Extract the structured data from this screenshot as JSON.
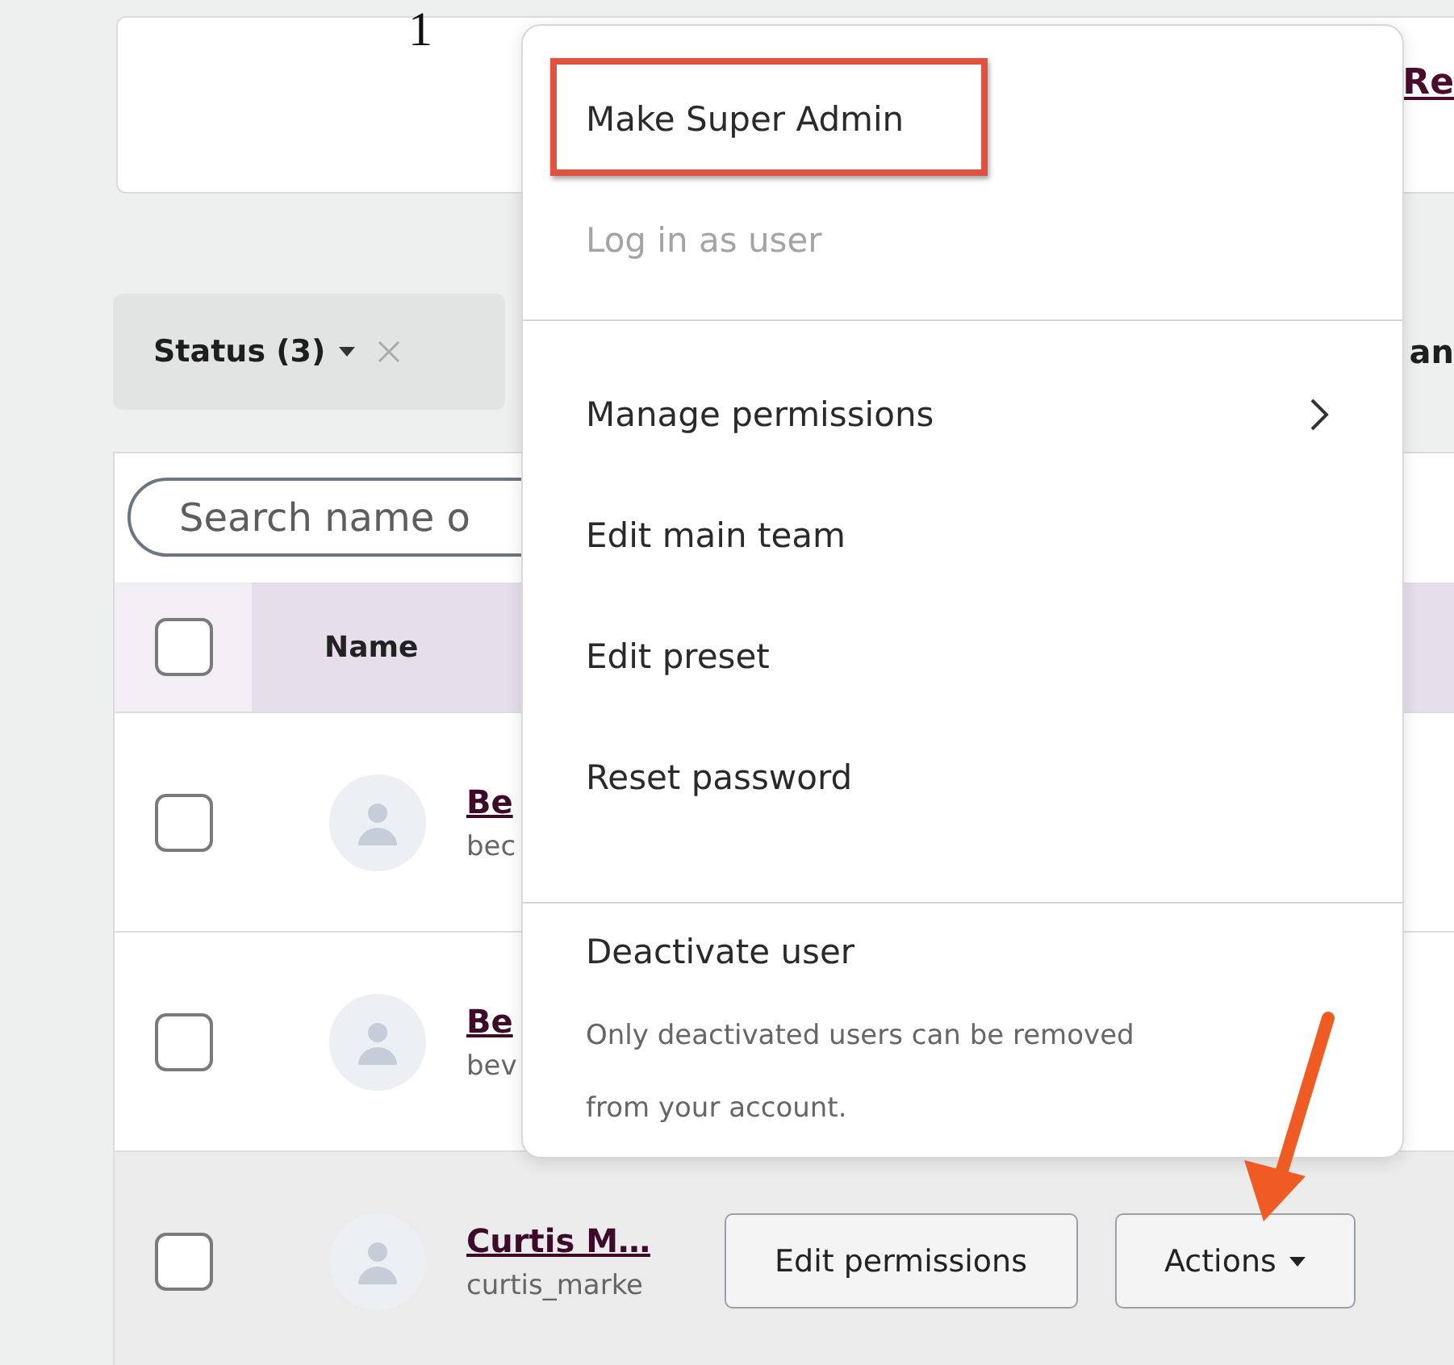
{
  "top_card": {
    "text": "1",
    "link": "Re"
  },
  "filter_bar": {
    "chip": {
      "label": "Status (3)"
    },
    "cut_text": "an"
  },
  "search": {
    "placeholder": "Search name o"
  },
  "table": {
    "header_checkbox": {
      "checked": false
    },
    "columns": [
      {
        "label": "Name"
      }
    ],
    "rows": [
      {
        "name": "Be",
        "handle": "bec",
        "checked": false,
        "hovered": false,
        "buttons": []
      },
      {
        "name": "Be",
        "handle": "bev",
        "checked": false,
        "hovered": false,
        "buttons": []
      },
      {
        "name": "Curtis M…",
        "handle": "curtis_marke",
        "checked": false,
        "hovered": true,
        "buttons": [
          {
            "label": "Edit permissions",
            "kind": "plain",
            "arrow": false
          },
          {
            "label": "Actions",
            "kind": "dropdown",
            "arrow": true
          }
        ]
      }
    ]
  },
  "menu": {
    "sections": [
      {
        "items": [
          {
            "label": "Make Super Admin",
            "disabled": false,
            "highlighted": true,
            "submenu": false
          },
          {
            "label": "Log in as user",
            "disabled": true,
            "highlighted": false,
            "submenu": false
          }
        ]
      },
      {
        "items": [
          {
            "label": "Manage permissions",
            "disabled": false,
            "highlighted": false,
            "submenu": true
          },
          {
            "label": "Edit main team",
            "disabled": false,
            "highlighted": false,
            "submenu": false
          },
          {
            "label": "Edit preset",
            "disabled": false,
            "highlighted": false,
            "submenu": false
          },
          {
            "label": "Reset password",
            "disabled": false,
            "highlighted": false,
            "submenu": false
          }
        ]
      },
      {
        "items": [
          {
            "label": "Deactivate user",
            "disabled": false,
            "highlighted": false,
            "submenu": false
          }
        ],
        "note": "Only deactivated users can be removed from your account."
      }
    ]
  }
}
